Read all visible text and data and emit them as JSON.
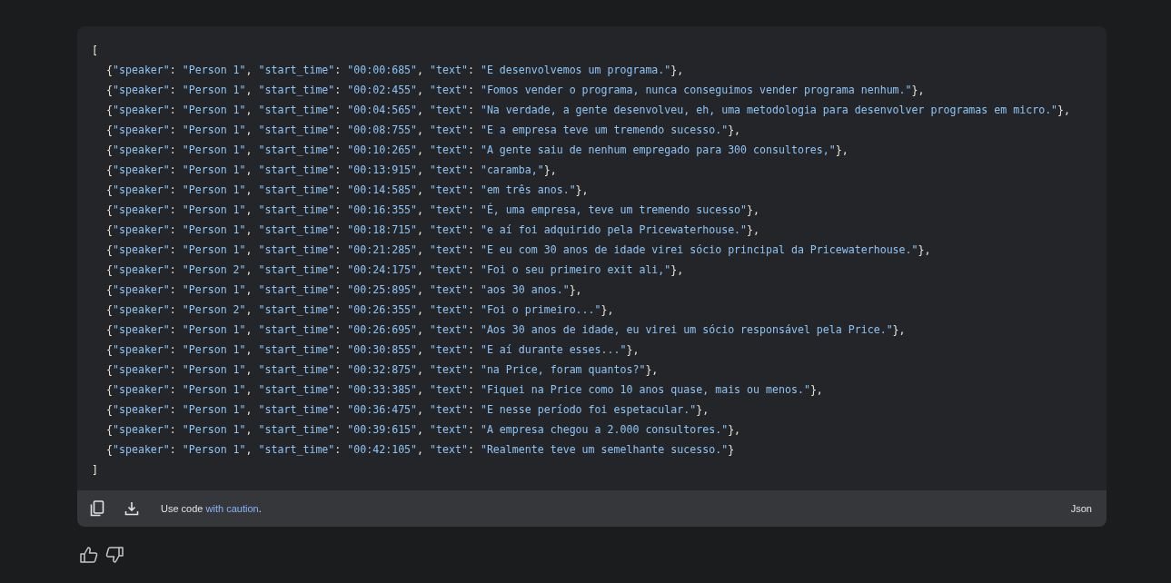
{
  "code_block": {
    "lines": [
      {
        "text": "[",
        "children": [
          {
            "text": "{\"speaker\": \"Person 1\", \"start_time\": \"00:00:685\", \"text\": \"E desenvolvemos um programa.\"},"
          },
          {
            "text": "{\"speaker\": \"Person 1\", \"start_time\": \"00:02:455\", \"text\": \"Fomos vender o programa, nunca conseguimos vender programa nenhum.\"},"
          },
          {
            "text": "{\"speaker\": \"Person 1\", \"start_time\": \"00:04:565\", \"text\": \"Na verdade, a gente desenvolveu, eh, uma metodologia para desenvolver programas em micro.\"},"
          },
          {
            "text": "{\"speaker\": \"Person 1\", \"start_time\": \"00:08:755\", \"text\": \"E a empresa teve um tremendo sucesso.\"},"
          },
          {
            "text": "{\"speaker\": \"Person 1\", \"start_time\": \"00:10:265\", \"text\": \"A gente saiu de nenhum empregado para 300 consultores,\"},"
          },
          {
            "text": "{\"speaker\": \"Person 1\", \"start_time\": \"00:13:915\", \"text\": \"caramba,\"},"
          },
          {
            "text": "{\"speaker\": \"Person 1\", \"start_time\": \"00:14:585\", \"text\": \"em três anos.\"},"
          },
          {
            "text": "{\"speaker\": \"Person 1\", \"start_time\": \"00:16:355\", \"text\": \"É, uma empresa, teve um tremendo sucesso\"},"
          },
          {
            "text": "{\"speaker\": \"Person 1\", \"start_time\": \"00:18:715\", \"text\": \"e aí foi adquirido pela Pricewaterhouse.\"},"
          },
          {
            "text": "{\"speaker\": \"Person 1\", \"start_time\": \"00:21:285\", \"text\": \"E eu com 30 anos de idade virei sócio principal da Pricewaterhouse.\"},"
          },
          {
            "text": "{\"speaker\": \"Person 2\", \"start_time\": \"00:24:175\", \"text\": \"Foi o seu primeiro exit ali,\"},"
          },
          {
            "text": "{\"speaker\": \"Person 1\", \"start_time\": \"00:25:895\", \"text\": \"aos 30 anos.\"},"
          },
          {
            "text": "{\"speaker\": \"Person 2\", \"start_time\": \"00:26:355\", \"text\": \"Foi o primeiro...\"},"
          },
          {
            "text": "{\"speaker\": \"Person 1\", \"start_time\": \"00:26:695\", \"text\": \"Aos 30 anos de idade, eu virei um sócio responsável pela Price.\"},"
          },
          {
            "text": "{\"speaker\": \"Person 1\", \"start_time\": \"00:30:855\", \"text\": \"E aí durante esses...\"},"
          },
          {
            "text": "{\"speaker\": \"Person 1\", \"start_time\": \"00:32:875\", \"text\": \"na Price, foram quantos?\"},"
          },
          {
            "text": "{\"speaker\": \"Person 1\", \"start_time\": \"00:33:385\", \"text\": \"Fiquei na Price como 10 anos quase, mais ou menos.\"},"
          },
          {
            "text": "{\"speaker\": \"Person 1\", \"start_time\": \"00:36:475\", \"text\": \"E nesse período foi espetacular.\"},"
          },
          {
            "text": "{\"speaker\": \"Person 1\", \"start_time\": \"00:39:615\", \"text\": \"A empresa chegou a 2.000 consultores.\"},"
          },
          {
            "text": "{\"speaker\": \"Person 1\", \"start_time\": \"00:42:105\", \"text\": \"Realmente teve um semelhante sucesso.\"}"
          }
        ]
      },
      {
        "text": "]"
      }
    ]
  },
  "footer": {
    "notice_prefix": "Use code ",
    "notice_link": "with caution",
    "notice_suffix": ".",
    "language": "Json"
  }
}
